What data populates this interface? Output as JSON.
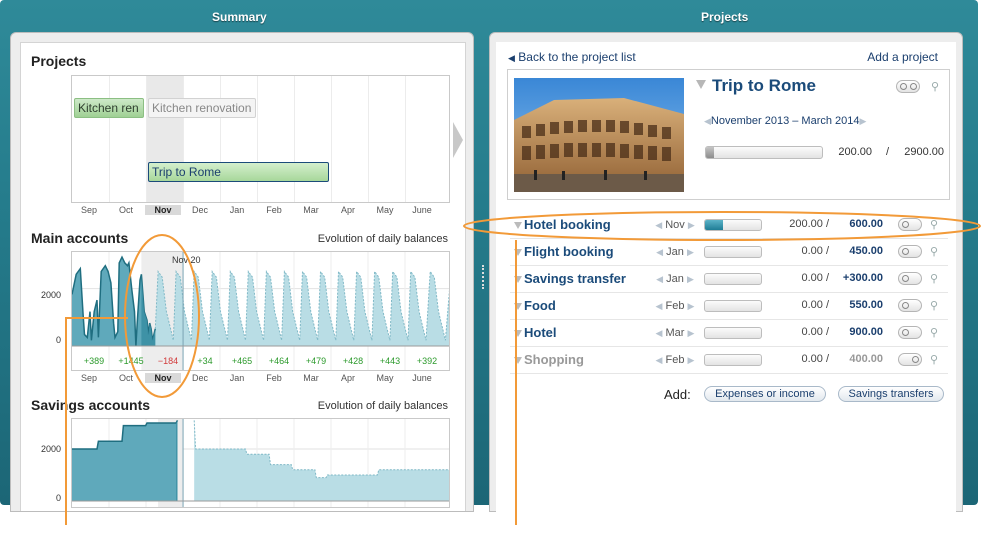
{
  "summary_header": "Summary",
  "projects_header": "Projects",
  "summary": {
    "projects_title": "Projects",
    "main_accounts_title": "Main accounts",
    "main_accounts_sub": "Evolution of daily balances",
    "savings_accounts_title": "Savings accounts",
    "savings_accounts_sub": "Evolution of daily balances",
    "months": [
      "Sep",
      "Oct",
      "Nov",
      "Dec",
      "Jan",
      "Feb",
      "Mar",
      "Apr",
      "May",
      "June"
    ],
    "timeline_bars": [
      {
        "label": "Kitchen ren",
        "state": "active"
      },
      {
        "label": "Kitchen renovation",
        "state": "ghost"
      },
      {
        "label": "Trip to Rome",
        "state": "selected"
      }
    ],
    "hover_label": "Nov 20",
    "axis_2000": "2000",
    "axis_0": "0",
    "savings_axis_2000": "2000",
    "savings_axis_0": "0",
    "month_deltas": [
      "+389",
      "+1445",
      "−184",
      "+34",
      "+465",
      "+464",
      "+479",
      "+428",
      "+443",
      "+392"
    ]
  },
  "chart_data": [
    {
      "type": "area",
      "title": "Main accounts",
      "subtitle": "Evolution of daily balances",
      "categories": [
        "Sep",
        "Oct",
        "Nov",
        "Dec",
        "Jan",
        "Feb",
        "Mar",
        "Apr",
        "May",
        "June"
      ],
      "ylim": [
        0,
        3000
      ],
      "y_ticks": [
        0,
        2000
      ],
      "series": [
        {
          "values": [
            [
              0,
              1800
            ],
            [
              3,
              2500
            ],
            [
              6,
              2700
            ],
            [
              8,
              1100
            ],
            [
              9,
              400
            ],
            [
              11,
              300
            ],
            [
              13,
              1200
            ],
            [
              14,
              200
            ],
            [
              16,
              1200
            ],
            [
              18,
              1600
            ],
            [
              19,
              300
            ],
            [
              21,
              2600
            ],
            [
              24,
              2800
            ],
            [
              26,
              2600
            ],
            [
              28,
              2200
            ],
            [
              30,
              800
            ],
            [
              31,
              300
            ],
            [
              33,
              500
            ],
            [
              34,
              2900
            ],
            [
              36,
              3100
            ],
            [
              38,
              2900
            ],
            [
              40,
              2800
            ],
            [
              41,
              2900
            ],
            [
              43,
              2000
            ],
            [
              45,
              1200
            ],
            [
              46,
              -200
            ],
            [
              47,
              800
            ],
            [
              49,
              2300
            ],
            [
              50,
              2500
            ],
            [
              52,
              1200
            ],
            [
              54,
              900
            ],
            [
              55,
              400
            ],
            [
              56,
              800
            ],
            [
              57,
              600
            ],
            [
              58,
              200
            ],
            [
              60,
              600
            ],
            [
              62,
              2600
            ],
            [
              65,
              2400
            ],
            [
              68,
              1200
            ],
            [
              71,
              600
            ],
            [
              73,
              200
            ],
            [
              75,
              2600
            ],
            [
              78,
              2400
            ],
            [
              81,
              1200
            ],
            [
              84,
              600
            ],
            [
              86,
              200
            ],
            [
              88,
              2600
            ],
            [
              91,
              2400
            ],
            [
              94,
              1200
            ],
            [
              97,
              600
            ],
            [
              99,
              200
            ],
            [
              101,
              2600
            ],
            [
              104,
              2400
            ],
            [
              107,
              1200
            ],
            [
              110,
              600
            ],
            [
              112,
              200
            ],
            [
              114,
              2600
            ],
            [
              117,
              2400
            ],
            [
              120,
              1200
            ],
            [
              123,
              600
            ],
            [
              125,
              200
            ],
            [
              127,
              2600
            ],
            [
              130,
              2400
            ],
            [
              133,
              1200
            ],
            [
              136,
              600
            ],
            [
              138,
              200
            ],
            [
              140,
              2600
            ],
            [
              143,
              2400
            ],
            [
              146,
              1200
            ],
            [
              149,
              600
            ],
            [
              151,
              200
            ],
            [
              153,
              2600
            ],
            [
              156,
              2400
            ],
            [
              159,
              1200
            ],
            [
              162,
              600
            ],
            [
              164,
              200
            ],
            [
              166,
              2600
            ],
            [
              169,
              2400
            ],
            [
              172,
              1200
            ],
            [
              175,
              600
            ],
            [
              177,
              200
            ],
            [
              179,
              2600
            ],
            [
              182,
              2400
            ],
            [
              185,
              1200
            ],
            [
              188,
              600
            ],
            [
              190,
              200
            ],
            [
              192,
              2600
            ],
            [
              195,
              2400
            ],
            [
              198,
              1200
            ],
            [
              201,
              600
            ],
            [
              203,
              200
            ],
            [
              205,
              2600
            ],
            [
              208,
              2400
            ],
            [
              211,
              1200
            ],
            [
              214,
              600
            ],
            [
              216,
              200
            ],
            [
              218,
              2600
            ],
            [
              221,
              2400
            ],
            [
              224,
              1200
            ],
            [
              227,
              600
            ],
            [
              229,
              200
            ],
            [
              231,
              2600
            ],
            [
              234,
              2400
            ],
            [
              237,
              1200
            ],
            [
              240,
              600
            ],
            [
              242,
              200
            ],
            [
              244,
              2600
            ],
            [
              247,
              2400
            ],
            [
              250,
              1200
            ],
            [
              253,
              600
            ],
            [
              255,
              200
            ],
            [
              258,
              2600
            ],
            [
              261,
              2400
            ],
            [
              264,
              1200
            ],
            [
              267,
              600
            ],
            [
              269,
              200
            ],
            [
              273,
              2600
            ]
          ]
        }
      ],
      "day_range": [
        0,
        273
      ],
      "divider_day": 80,
      "current_month_days": [
        50,
        80
      ],
      "solid_until_day": 60,
      "deltas": [
        "+389",
        "+1445",
        "−184",
        "+34",
        "+465",
        "+464",
        "+479",
        "+428",
        "+443",
        "+392"
      ]
    },
    {
      "type": "area",
      "title": "Savings accounts",
      "subtitle": "Evolution of daily balances",
      "categories": [
        "Sep",
        "Oct",
        "Nov",
        "Dec",
        "Jan",
        "Feb",
        "Mar",
        "Apr",
        "May",
        "June"
      ],
      "ylim": [
        0,
        3000
      ],
      "y_ticks": [
        0,
        2000
      ],
      "series": [
        {
          "values": [
            [
              0,
              2000
            ],
            [
              18,
              2000
            ],
            [
              19,
              2300
            ],
            [
              36,
              2300
            ],
            [
              37,
              2900
            ],
            [
              53,
              2900
            ],
            [
              54,
              3000
            ],
            [
              75,
              3000
            ],
            [
              76,
              3100
            ],
            [
              88,
              3100
            ],
            [
              89,
              2000
            ],
            [
              125,
              2000
            ],
            [
              126,
              1800
            ],
            [
              142,
              1800
            ],
            [
              143,
              1400
            ],
            [
              158,
              1400
            ],
            [
              159,
              1200
            ],
            [
              175,
              1200
            ],
            [
              176,
              900
            ],
            [
              183,
              900
            ],
            [
              184,
              1000
            ],
            [
              220,
              1000
            ],
            [
              221,
              1200
            ],
            [
              273,
              1200
            ]
          ]
        }
      ],
      "day_range": [
        0,
        273
      ],
      "divider_day": 80,
      "current_month_days": [
        62,
        80
      ],
      "solid_until_day": 80
    }
  ],
  "projects": {
    "back_link": "Back to the project list",
    "add_link": "Add a project",
    "detail": {
      "title": "Trip to Rome",
      "date_range": "November 2013 – March 2014",
      "saved": "200.00",
      "separator": "/",
      "goal": "2900.00",
      "progress": 0.07
    },
    "rows": [
      {
        "name": "Hotel booking",
        "month": "Nov",
        "value": "200.00",
        "sep": "/",
        "total": "600.00",
        "progress": 0.33,
        "dim": false
      },
      {
        "name": "Flight booking",
        "month": "Jan",
        "value": "0.00",
        "sep": "/",
        "total": "450.00",
        "progress": 0,
        "dim": false
      },
      {
        "name": "Savings transfer",
        "month": "Jan",
        "value": "0.00",
        "sep": "/",
        "total": "+300.00",
        "progress": 0,
        "dim": false
      },
      {
        "name": "Food",
        "month": "Feb",
        "value": "0.00",
        "sep": "/",
        "total": "550.00",
        "progress": 0,
        "dim": false
      },
      {
        "name": "Hotel",
        "month": "Mar",
        "value": "0.00",
        "sep": "/",
        "total": "900.00",
        "progress": 0,
        "dim": false
      },
      {
        "name": "Shopping",
        "month": "Feb",
        "value": "0.00",
        "sep": "/",
        "total": "400.00",
        "progress": 0,
        "dim": true
      }
    ],
    "add_label": "Add:",
    "add_expenses_button": "Expenses or income",
    "add_savings_button": "Savings transfers"
  },
  "colors": {
    "accent": "#2a8a9a",
    "area_fill": "#5fa9bb",
    "area_light": "#b9dde5",
    "annotation": "#f29a38",
    "link": "#1b3f6e"
  }
}
